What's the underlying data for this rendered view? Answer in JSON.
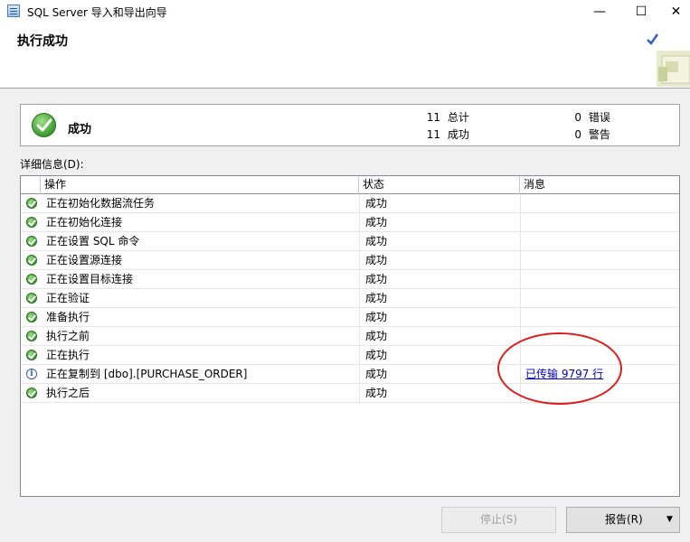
{
  "window": {
    "title": "SQL Server 导入和导出向导",
    "minimize": "—",
    "maximize": "☐",
    "close": "✕"
  },
  "header": {
    "title": "执行成功"
  },
  "summary": {
    "status": "成功",
    "total_count": "11",
    "total_label": "总计",
    "success_count": "11",
    "success_label": "成功",
    "error_count": "0",
    "error_label": "错误",
    "warning_count": "0",
    "warning_label": "警告"
  },
  "details": {
    "label": "详细信息(D):",
    "columns": [
      "操作",
      "状态",
      "消息"
    ],
    "rows": [
      {
        "icon": "success-icon",
        "action": "正在初始化数据流任务",
        "status": "成功",
        "message": ""
      },
      {
        "icon": "success-icon",
        "action": "正在初始化连接",
        "status": "成功",
        "message": ""
      },
      {
        "icon": "success-icon",
        "action": "正在设置 SQL 命令",
        "status": "成功",
        "message": ""
      },
      {
        "icon": "success-icon",
        "action": "正在设置源连接",
        "status": "成功",
        "message": ""
      },
      {
        "icon": "success-icon",
        "action": "正在设置目标连接",
        "status": "成功",
        "message": ""
      },
      {
        "icon": "success-icon",
        "action": "正在验证",
        "status": "成功",
        "message": ""
      },
      {
        "icon": "success-icon",
        "action": "准备执行",
        "status": "成功",
        "message": ""
      },
      {
        "icon": "success-icon",
        "action": "执行之前",
        "status": "成功",
        "message": ""
      },
      {
        "icon": "success-icon",
        "action": "正在执行",
        "status": "成功",
        "message": ""
      },
      {
        "icon": "info-icon",
        "action": "正在复制到 [dbo].[PURCHASE_ORDER]",
        "status": "成功",
        "message": "已传输 9797 行"
      },
      {
        "icon": "success-icon",
        "action": "执行之后",
        "status": "成功",
        "message": ""
      }
    ]
  },
  "buttons": {
    "stop": "停止(S)",
    "report": "报告(R)",
    "report_arrow": "▼"
  },
  "colors": {
    "annotation": "#e01b1b",
    "link": "#0000cc",
    "success_green": "#3a9c2c"
  }
}
